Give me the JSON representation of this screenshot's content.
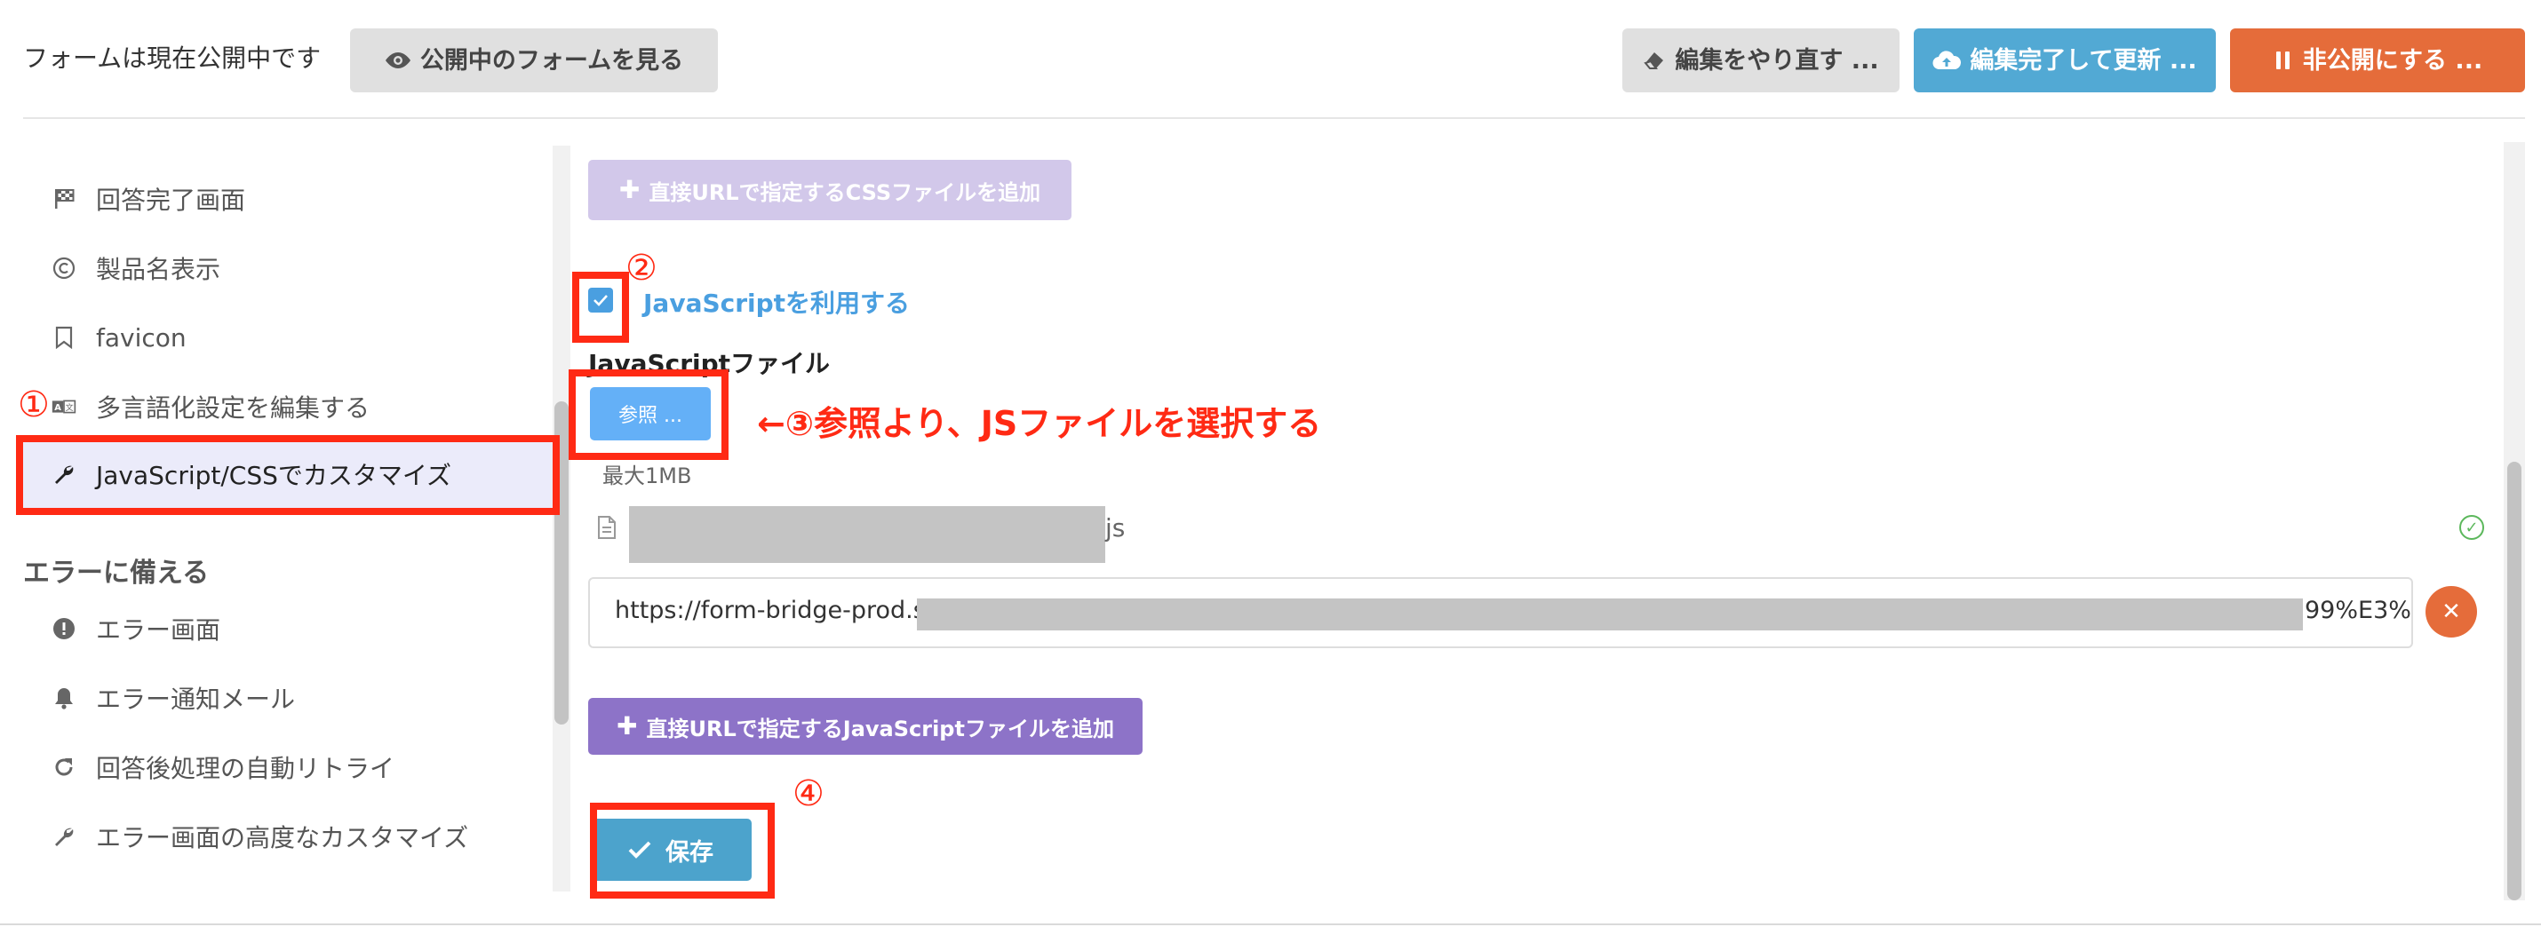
{
  "header": {
    "status_text": "フォームは現在公開中です",
    "view_form_label": "公開中のフォームを見る",
    "undo_label": "編集をやり直す ...",
    "update_label": "編集完了して更新 ...",
    "unpublish_label": "非公開にする ..."
  },
  "sidebar": {
    "items": [
      {
        "label": "回答完了画面",
        "icon": "checkered-flag-icon"
      },
      {
        "label": "製品名表示",
        "icon": "copyright-icon"
      },
      {
        "label": "favicon",
        "icon": "bookmark-icon"
      },
      {
        "label": "多言語化設定を編集する",
        "icon": "language-icon"
      },
      {
        "label": "JavaScript/CSSでカスタマイズ",
        "icon": "wrench-icon",
        "active": true
      }
    ],
    "section_title": "エラーに備える",
    "error_items": [
      {
        "label": "エラー画面",
        "icon": "exclamation-circle-icon"
      },
      {
        "label": "エラー通知メール",
        "icon": "bell-icon"
      },
      {
        "label": "回答後処理の自動リトライ",
        "icon": "redo-icon"
      },
      {
        "label": "エラー画面の高度なカスタマイズ",
        "icon": "wrench-icon"
      }
    ]
  },
  "main": {
    "add_css_url_label": "直接URLで指定するCSSファイルを追加",
    "use_js_label": "JavaScriptを利用する",
    "use_js_checked": true,
    "js_file_label": "JavaScriptファイル",
    "browse_label": "参照 ...",
    "max_size": "最大1MB",
    "file_ext": "js",
    "url_prefix": "https://form-bridge-prod.s3",
    "url_suffix": "99%E3%",
    "add_js_url_label": "直接URLで指定するJavaScriptファイルを追加",
    "save_label": "保存"
  },
  "annotations": {
    "step1": "①",
    "step2": "②",
    "step3_text": "←③参照より、JSファイルを選択する",
    "step4": "④"
  },
  "colors": {
    "accent_blue": "#4a9fe0",
    "update_blue": "#52a9d4",
    "unpublish_orange": "#e56c3a",
    "purple": "#8d73c8",
    "annotation_red": "#ff2a14"
  }
}
